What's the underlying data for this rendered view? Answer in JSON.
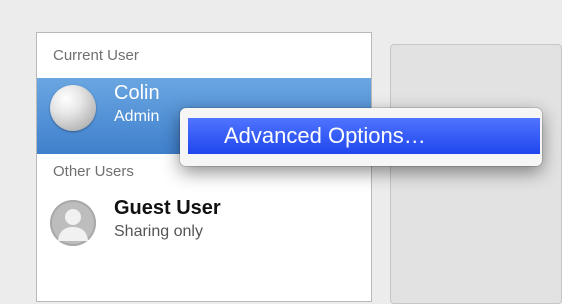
{
  "sidebar": {
    "current_user_header": "Current User",
    "other_users_header": "Other Users",
    "current_user": {
      "name": "Colin",
      "role": "Admin",
      "avatar_icon": "golf-ball-avatar-icon"
    },
    "other_users": [
      {
        "name": "Guest User",
        "role": "Sharing only",
        "avatar_icon": "guest-silhouette-icon"
      }
    ]
  },
  "context_menu": {
    "items": [
      {
        "label": "Advanced Options…"
      }
    ]
  },
  "colors": {
    "selection_blue": "#3f80cd",
    "menu_highlight": "#2b4ff0"
  }
}
